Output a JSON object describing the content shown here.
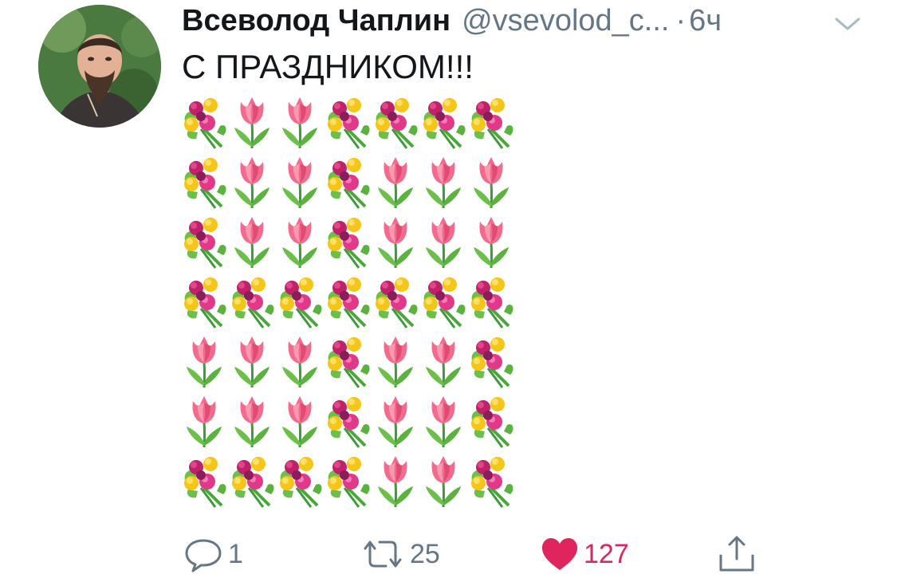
{
  "tweet": {
    "author_name": "Всеволод Чаплин",
    "handle": "@vsevolod_c...",
    "separator": "·",
    "time": "6ч",
    "text": "С ПРАЗДНИКОМ!!!",
    "emoji_grid": [
      [
        "bouquet",
        "tulip",
        "tulip",
        "bouquet",
        "bouquet",
        "bouquet",
        "bouquet"
      ],
      [
        "bouquet",
        "tulip",
        "tulip",
        "bouquet",
        "tulip",
        "tulip",
        "tulip"
      ],
      [
        "bouquet",
        "tulip",
        "tulip",
        "bouquet",
        "tulip",
        "tulip",
        "tulip"
      ],
      [
        "bouquet",
        "bouquet",
        "bouquet",
        "bouquet",
        "bouquet",
        "bouquet",
        "bouquet"
      ],
      [
        "tulip",
        "tulip",
        "tulip",
        "bouquet",
        "tulip",
        "tulip",
        "bouquet"
      ],
      [
        "tulip",
        "tulip",
        "tulip",
        "bouquet",
        "tulip",
        "tulip",
        "bouquet"
      ],
      [
        "bouquet",
        "bouquet",
        "bouquet",
        "bouquet",
        "tulip",
        "tulip",
        "bouquet"
      ]
    ]
  },
  "actions": {
    "reply": {
      "icon": "reply-icon",
      "count": "1"
    },
    "retweet": {
      "icon": "retweet-icon",
      "count": "25"
    },
    "like": {
      "icon": "heart-icon",
      "count": "127",
      "liked": true,
      "color": "#e0245e"
    },
    "share": {
      "icon": "share-icon"
    }
  },
  "colors": {
    "text": "#14171a",
    "secondary": "#657786",
    "like": "#e0245e"
  }
}
